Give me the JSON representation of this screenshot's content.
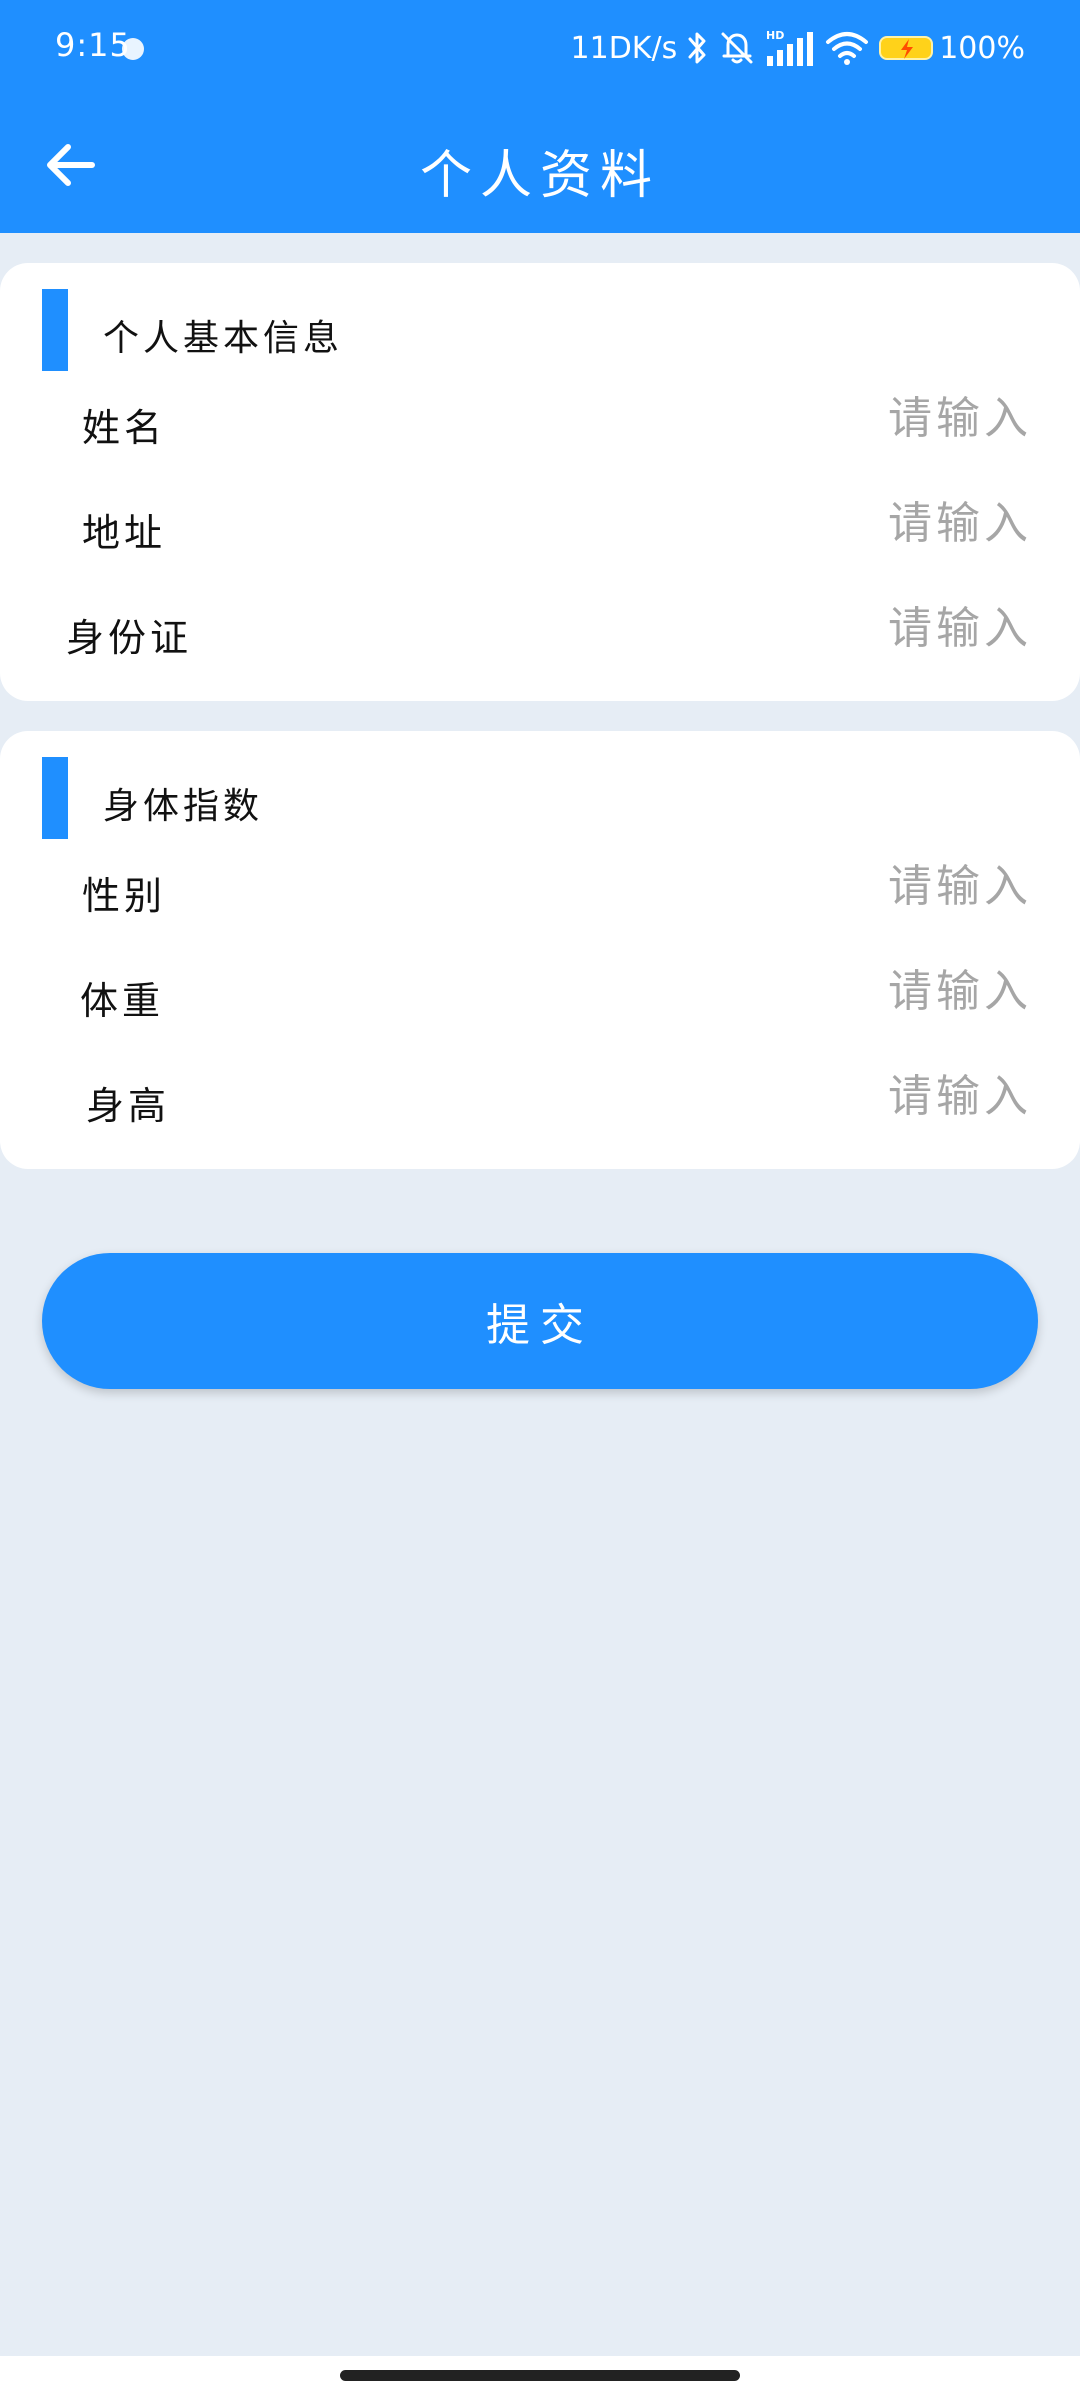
{
  "colors": {
    "primary": "#1f8fff",
    "page_background": "#e6edf5",
    "card_background": "#ffffff",
    "placeholder": "#a6a6a6",
    "battery": "#ffd21a"
  },
  "status_bar": {
    "time": "9:15",
    "network_speed": "11DK/s",
    "battery": "100%",
    "icons": [
      "app-notification-icon",
      "bluetooth-icon",
      "bell-off-icon",
      "hd-signal-icon",
      "wifi-icon",
      "battery-charging-icon"
    ]
  },
  "app_bar": {
    "title": "个人资料",
    "back_icon": "arrow-left-icon"
  },
  "sections": [
    {
      "title": "个人基本信息",
      "fields": [
        {
          "label": "姓名",
          "placeholder": "请输入",
          "value": ""
        },
        {
          "label": "地址",
          "placeholder": "请输入",
          "value": ""
        },
        {
          "label": "身份证",
          "placeholder": "请输入",
          "value": ""
        }
      ]
    },
    {
      "title": "身体指数",
      "fields": [
        {
          "label": "性别",
          "placeholder": "请输入",
          "value": ""
        },
        {
          "label": "体重",
          "placeholder": "请输入",
          "value": ""
        },
        {
          "label": "身高",
          "placeholder": "请输入",
          "value": ""
        }
      ]
    }
  ],
  "submit_label": "提交"
}
